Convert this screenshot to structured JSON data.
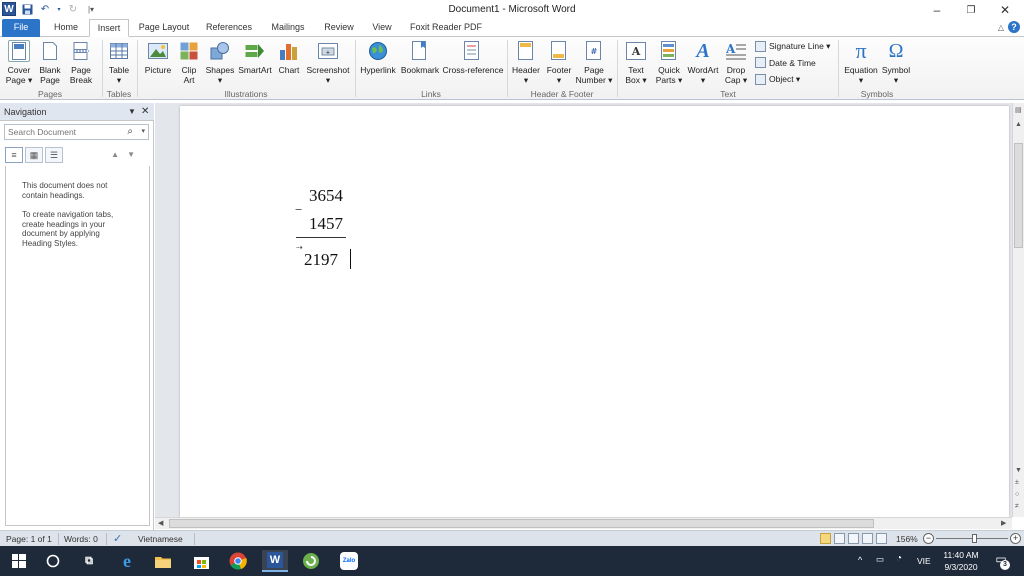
{
  "window": {
    "title": "Document1 - Microsoft Word",
    "minimize": "–",
    "restore": "❐",
    "close": "✕"
  },
  "tabs": [
    "File",
    "Home",
    "Insert",
    "Page Layout",
    "References",
    "Mailings",
    "Review",
    "View",
    "Foxit Reader PDF"
  ],
  "active_tab": "Insert",
  "ribbon": {
    "pages": {
      "cover_page": [
        "Cover",
        "Page ▾"
      ],
      "blank_page": [
        "Blank",
        "Page"
      ],
      "page_break": [
        "Page",
        "Break"
      ],
      "label": "Pages"
    },
    "tables": {
      "table": [
        "Table",
        "▾"
      ],
      "label": "Tables"
    },
    "illustrations": {
      "picture": "Picture",
      "clip_art": [
        "Clip",
        "Art"
      ],
      "shapes": [
        "Shapes",
        "▾"
      ],
      "smartart": "SmartArt",
      "chart": "Chart",
      "screenshot": [
        "Screenshot",
        "▾"
      ],
      "label": "Illustrations"
    },
    "links": {
      "hyperlink": "Hyperlink",
      "bookmark": "Bookmark",
      "cross_reference": "Cross-reference",
      "label": "Links"
    },
    "header_footer": {
      "header": [
        "Header",
        "▾"
      ],
      "footer": [
        "Footer",
        "▾"
      ],
      "page_number": [
        "Page",
        "Number ▾"
      ],
      "label": "Header & Footer"
    },
    "text": {
      "text_box": [
        "Text",
        "Box ▾"
      ],
      "quick_parts": [
        "Quick",
        "Parts ▾"
      ],
      "wordart": [
        "WordArt",
        "▾"
      ],
      "drop_cap": [
        "Drop",
        "Cap ▾"
      ],
      "signature_line": "Signature Line ▾",
      "date_time": "Date & Time",
      "object": "Object ▾",
      "label": "Text"
    },
    "symbols": {
      "equation": [
        "Equation",
        "▾"
      ],
      "symbol": [
        "Symbol",
        "▾"
      ],
      "label": "Symbols"
    }
  },
  "navigation": {
    "title": "Navigation",
    "search_placeholder": "Search Document",
    "msg1": "This document does not contain headings.",
    "msg2": "To create navigation tabs, create headings in your document by applying Heading Styles."
  },
  "document": {
    "minuend": "3654",
    "subtrahend": "1457",
    "difference": "2197",
    "minus_sign": "−"
  },
  "status": {
    "page": "Page: 1 of 1",
    "words": "Words: 0",
    "language": "Vietnamese",
    "zoom": "156%"
  },
  "taskbar": {
    "lang": "VIE",
    "time": "11:40 AM",
    "date": "9/3/2020",
    "notifications": "3",
    "zalo": "Zalo"
  },
  "colors": {
    "word_blue": "#2b579a",
    "file_tab": "#2b74c7",
    "taskbar": "#1e2a3a"
  }
}
